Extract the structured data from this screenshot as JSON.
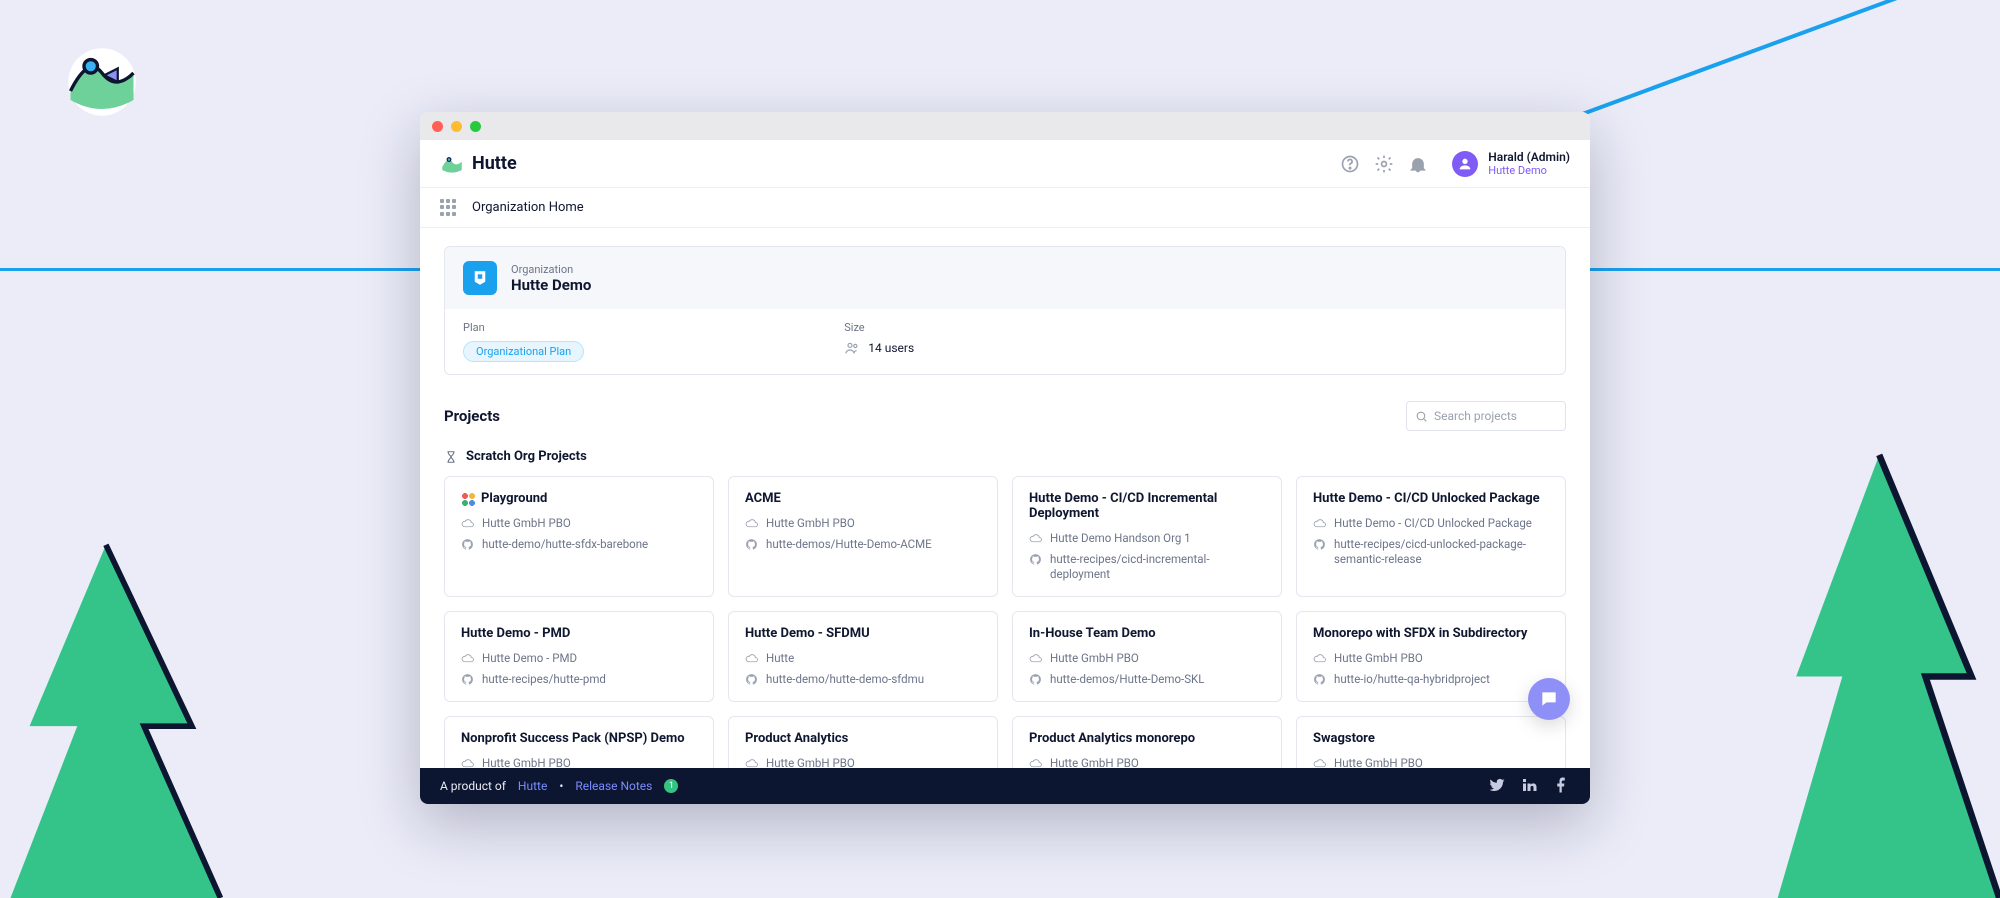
{
  "brand": "Hutte",
  "crumb": "Organization Home",
  "user": {
    "name": "Harald (Admin)",
    "org": "Hutte Demo"
  },
  "orgcard": {
    "label": "Organization",
    "name": "Hutte Demo",
    "plan_label": "Plan",
    "plan_value": "Organizational Plan",
    "size_label": "Size",
    "size_value": "14 users"
  },
  "projects_heading": "Projects",
  "section_heading": "Scratch Org Projects",
  "search_placeholder": "Search projects",
  "cards": {
    "c0": {
      "title": "Playground",
      "org": "Hutte GmbH PBO",
      "repo": "hutte-demo/hutte-sfdx-barebone"
    },
    "c1": {
      "title": "ACME",
      "org": "Hutte GmbH PBO",
      "repo": "hutte-demos/Hutte-Demo-ACME"
    },
    "c2": {
      "title": "Hutte Demo - CI/CD Incremental Deployment",
      "org": "Hutte Demo Handson Org 1",
      "repo": "hutte-recipes/cicd-incremental-deployment"
    },
    "c3": {
      "title": "Hutte Demo - CI/CD Unlocked Package",
      "org": "Hutte Demo - CI/CD Unlocked Package",
      "repo": "hutte-recipes/cicd-unlocked-package-semantic-release"
    },
    "c4": {
      "title": "Hutte Demo - PMD",
      "org": "Hutte Demo - PMD",
      "repo": "hutte-recipes/hutte-pmd"
    },
    "c5": {
      "title": "Hutte Demo - SFDMU",
      "org": "Hutte",
      "repo": "hutte-demo/hutte-demo-sfdmu"
    },
    "c6": {
      "title": "In-House Team Demo",
      "org": "Hutte GmbH PBO",
      "repo": "hutte-demos/Hutte-Demo-SKL"
    },
    "c7": {
      "title": "Monorepo with SFDX in Subdirectory",
      "org": "Hutte GmbH PBO",
      "repo": "hutte-io/hutte-qa-hybridproject"
    },
    "c8": {
      "title": "Nonprofit Success Pack (NPSP) Demo",
      "org": "Hutte GmbH PBO"
    },
    "c9": {
      "title": "Product Analytics",
      "org": "Hutte GmbH PBO"
    },
    "c10": {
      "title": "Product Analytics monorepo",
      "org": "Hutte GmbH PBO"
    },
    "c11": {
      "title": "Swagstore",
      "org": "Hutte GmbH PBO"
    }
  },
  "footer": {
    "prefix": "A product of ",
    "brand": "Hutte",
    "release_notes": "Release Notes",
    "badge": "1"
  }
}
